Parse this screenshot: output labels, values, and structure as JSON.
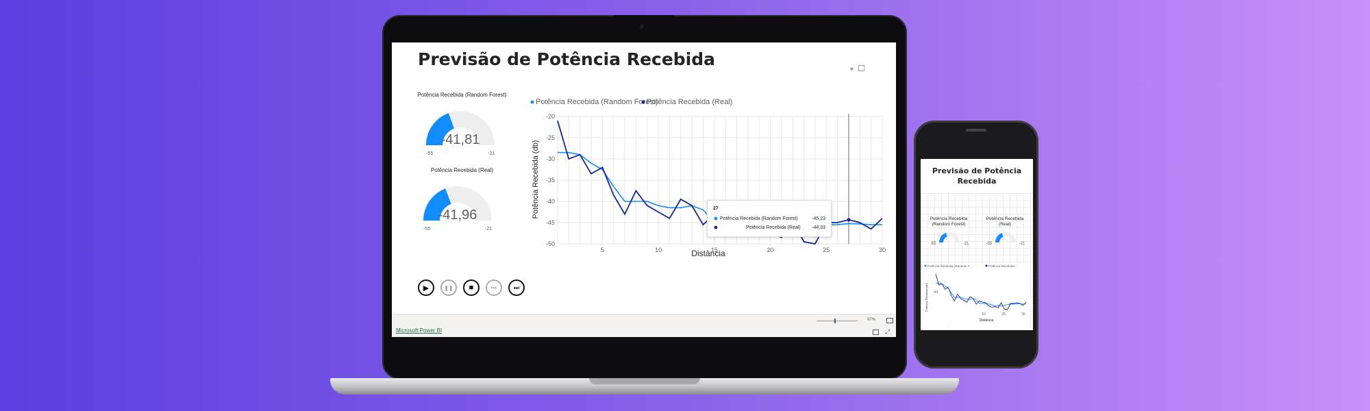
{
  "report": {
    "title": "Previsão de Potência Recebida",
    "footer_link": "Microsoft Power BI",
    "zoom": "97%"
  },
  "gauges": [
    {
      "label": "Potência Recebida (Random Forest)",
      "value": "-41,81",
      "min": "-55",
      "max": "-21",
      "num": -41.81,
      "lo": -55,
      "hi": -21
    },
    {
      "label": "Potência Recebida (Real)",
      "value": "-41,96",
      "min": "-55",
      "max": "-21",
      "num": -41.96,
      "lo": -55,
      "hi": -21
    }
  ],
  "player": {
    "buttons": [
      {
        "name": "play-button",
        "icon": "play-icon",
        "glyph": "▶",
        "enabled": true
      },
      {
        "name": "pause-button",
        "icon": "pause-icon",
        "glyph": "❚❚",
        "enabled": false
      },
      {
        "name": "stop-button",
        "icon": "stop-icon",
        "glyph": "■",
        "enabled": true
      },
      {
        "name": "previous-button",
        "icon": "skip-back-icon",
        "glyph": "⏮",
        "enabled": false
      },
      {
        "name": "next-button",
        "icon": "skip-forward-icon",
        "glyph": "⏭",
        "enabled": true
      }
    ]
  },
  "chart_data": {
    "type": "line",
    "xlabel": "Distância",
    "ylabel": "Potência Recebida (db)",
    "xlim": [
      1,
      30
    ],
    "ylim": [
      -50,
      -20
    ],
    "xticks": [
      "5",
      "10",
      "15",
      "20",
      "25",
      "30"
    ],
    "yticks": [
      "-20",
      "-25",
      "-30",
      "-35",
      "-40",
      "-45",
      "-50"
    ],
    "grid": true,
    "legend_position": "top-left",
    "series": [
      {
        "name": "Potência Recebida (Random Forest)",
        "color": "#118dff",
        "x": [
          1,
          2,
          3,
          4,
          5,
          6,
          7,
          8,
          9,
          10,
          11,
          12,
          13,
          14,
          15,
          16,
          17,
          18,
          19,
          20,
          21,
          22,
          23,
          24,
          25,
          26,
          27,
          28,
          29,
          30
        ],
        "values": [
          -28.5,
          -28.5,
          -29,
          -31,
          -32.5,
          -36.5,
          -40,
          -40,
          -40,
          -41,
          -41.5,
          -41.5,
          -41,
          -42,
          -45,
          -45,
          -45,
          -45.5,
          -46,
          -47,
          -47,
          -47,
          -46.5,
          -46,
          -45.5,
          -45.5,
          -45.23,
          -45.3,
          -45.5,
          -45.5
        ]
      },
      {
        "name": "Potência Recebida (Real)",
        "color": "#12239e",
        "x": [
          1,
          2,
          3,
          4,
          5,
          6,
          7,
          8,
          9,
          10,
          11,
          12,
          13,
          14,
          15,
          16,
          17,
          18,
          19,
          20,
          21,
          22,
          23,
          24,
          25,
          26,
          27,
          28,
          29,
          30
        ],
        "values": [
          -21,
          -30,
          -29,
          -33.5,
          -32,
          -38.5,
          -43,
          -37.5,
          -41,
          -42.5,
          -44,
          -39.5,
          -41,
          -45.5,
          -43,
          -44,
          -44.5,
          -47,
          -48,
          -47.5,
          -48.5,
          -44.5,
          -49.5,
          -50,
          -45,
          -45,
          -44.33,
          -45,
          -46.5,
          -44
        ]
      }
    ],
    "tooltip": {
      "x": "27",
      "rows": [
        {
          "label": "Potência Recebida (Random Forest)",
          "value": "-45,23",
          "color": "#118dff"
        },
        {
          "label": "Potência Recebida (Real)",
          "value": "-44,33",
          "color": "#12239e"
        }
      ]
    }
  },
  "mobile": {
    "title_line1": "Previsão de Potência",
    "title_line2": "Recebida",
    "gauge1_label_1": "Potência Recebida",
    "gauge1_label_2": "(Random Forest)",
    "gauge2_label_1": "Potência Recebida",
    "gauge2_label_2": "(Real)",
    "gauge_min": "-55",
    "gauge_max": "-21",
    "legend_1": "Potência Recebida (Random F...",
    "legend_2": "Potência Recebida...",
    "ytick": "-40",
    "xticks": [
      "10",
      "20",
      "30"
    ],
    "xlabel": "Distância",
    "ylabel": "Potência Recebida (db)"
  }
}
